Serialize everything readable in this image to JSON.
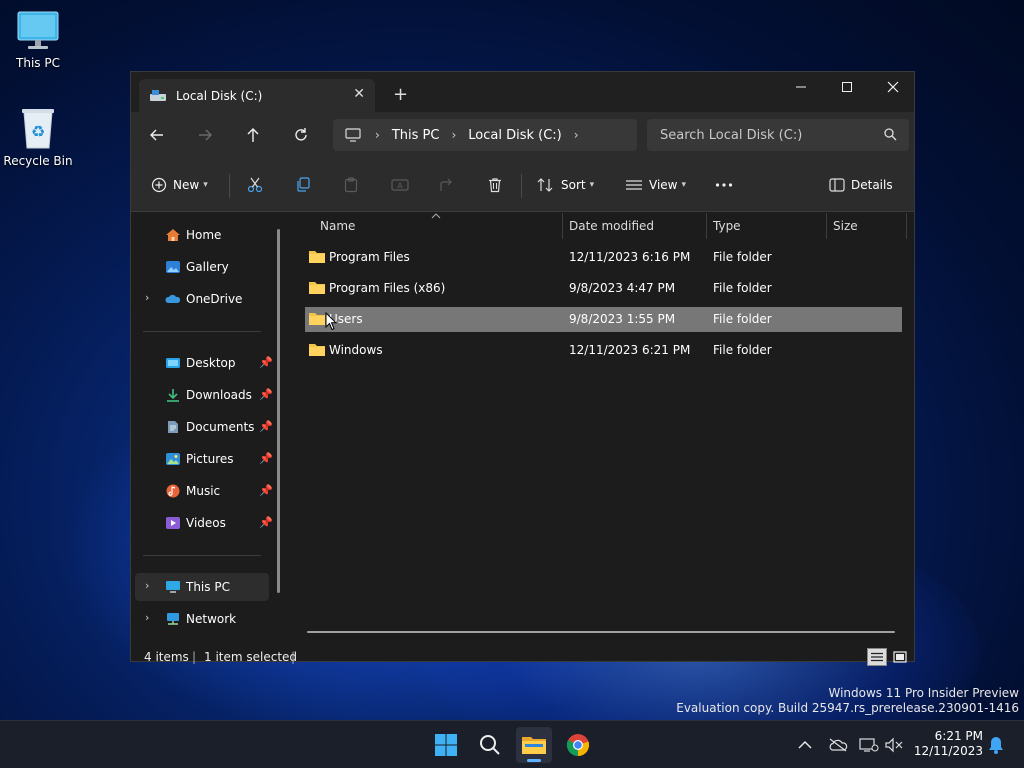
{
  "desktop": {
    "icons": [
      {
        "label": "This PC"
      },
      {
        "label": "Recycle Bin"
      }
    ],
    "watermark": {
      "line1": "Windows 11 Pro Insider Preview",
      "line2": "Evaluation copy. Build 25947.rs_prerelease.230901-1416"
    }
  },
  "window": {
    "tab_title": "Local Disk (C:)",
    "breadcrumb": [
      "This PC",
      "Local Disk (C:)"
    ],
    "search_placeholder": "Search Local Disk (C:)",
    "commands": {
      "new": "New",
      "sort": "Sort",
      "view": "View",
      "details": "Details"
    },
    "sidebar": {
      "items": [
        {
          "label": "Home",
          "icon": "home-icon"
        },
        {
          "label": "Gallery",
          "icon": "gallery-icon"
        },
        {
          "label": "OneDrive",
          "icon": "onedrive-icon"
        },
        {
          "label": "Desktop",
          "icon": "desktop-icon"
        },
        {
          "label": "Downloads",
          "icon": "downloads-icon"
        },
        {
          "label": "Documents",
          "icon": "documents-icon"
        },
        {
          "label": "Pictures",
          "icon": "pictures-icon"
        },
        {
          "label": "Music",
          "icon": "music-icon"
        },
        {
          "label": "Videos",
          "icon": "videos-icon"
        },
        {
          "label": "This PC",
          "icon": "this-pc-icon"
        },
        {
          "label": "Network",
          "icon": "network-icon"
        }
      ]
    },
    "columns": [
      "Name",
      "Date modified",
      "Type",
      "Size"
    ],
    "files": [
      {
        "name": "Program Files",
        "date": "12/11/2023 6:16 PM",
        "type": "File folder",
        "size": ""
      },
      {
        "name": "Program Files (x86)",
        "date": "9/8/2023 4:47 PM",
        "type": "File folder",
        "size": ""
      },
      {
        "name": "Users",
        "date": "9/8/2023 1:55 PM",
        "type": "File folder",
        "size": ""
      },
      {
        "name": "Windows",
        "date": "12/11/2023 6:21 PM",
        "type": "File folder",
        "size": ""
      }
    ],
    "status": {
      "items": "4 items",
      "selected": "1 item selected"
    }
  },
  "taskbar": {
    "time": "6:21 PM",
    "date": "12/11/2023"
  },
  "colors": {
    "accent": "#0078d4",
    "selection": "#777777",
    "folder": "#f3c44a"
  }
}
